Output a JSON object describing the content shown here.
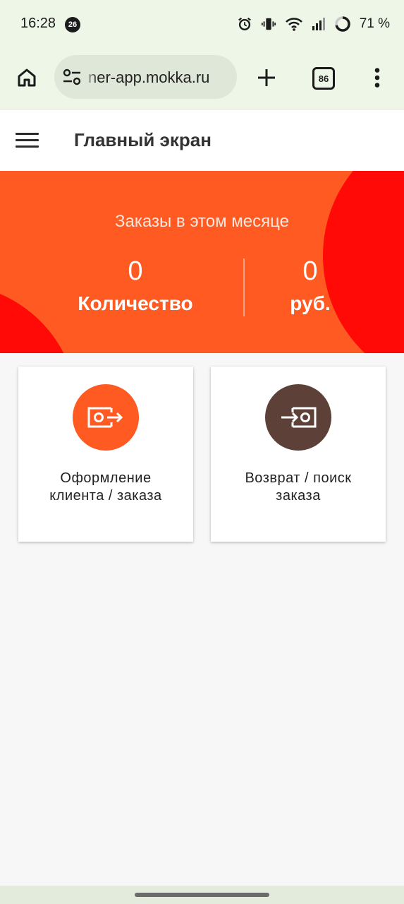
{
  "status_bar": {
    "time": "16:28",
    "notification_count": "26",
    "battery": "71 %",
    "icons": [
      "alarm-icon",
      "vibrate-icon",
      "wifi-icon",
      "signal-icon",
      "battery-ring-icon"
    ]
  },
  "browser": {
    "url": "ner-app.mokka.ru",
    "tab_count": "86",
    "icons": [
      "home-icon",
      "tune-icon",
      "plus-icon",
      "more-vert-icon"
    ]
  },
  "header": {
    "title": "Главный экран",
    "menu_icon": "menu-icon"
  },
  "banner": {
    "title": "Заказы в этом месяце",
    "count_value": "0",
    "count_label": "Количество",
    "sum_value": "0",
    "sum_label": "руб."
  },
  "cards": [
    {
      "line1": "Оформление",
      "line2": "клиента / заказа",
      "icon": "checkout-arrow-icon",
      "color": "#ff5a22"
    },
    {
      "line1": "Возврат / поиск",
      "line2": "заказа",
      "icon": "return-arrow-icon",
      "color": "#5d4138"
    }
  ],
  "colors": {
    "accent": "#ff5a22",
    "accent_dark": "#ff0a06",
    "brown": "#5d4138"
  }
}
